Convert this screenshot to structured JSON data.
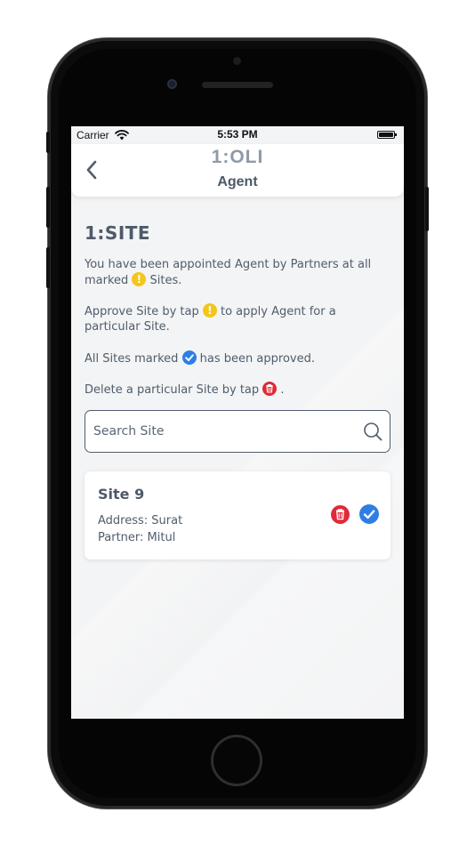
{
  "status_bar": {
    "carrier": "Carrier",
    "time": "5:53 PM"
  },
  "header": {
    "logo": "1:OLI",
    "title": "Agent"
  },
  "section": {
    "title": "1:SITE"
  },
  "info": {
    "line1_a": "You have been appointed Agent by Partners at all marked ",
    "line1_b": " Sites.",
    "line2_a": "Approve Site by tap ",
    "line2_b": " to apply Agent for a particular Site.",
    "line3_a": "All Sites marked ",
    "line3_b": " has been approved.",
    "line4_a": "Delete a particular Site by tap ",
    "line4_b": " ."
  },
  "search": {
    "placeholder": "Search Site"
  },
  "sites": [
    {
      "name": "Site 9",
      "address": "Address: Surat",
      "partner": "Partner: Mitul"
    }
  ],
  "colors": {
    "warning": "#f5c518",
    "approved": "#2f7ee6",
    "delete": "#e02a38",
    "text": "#4f5d6c"
  }
}
